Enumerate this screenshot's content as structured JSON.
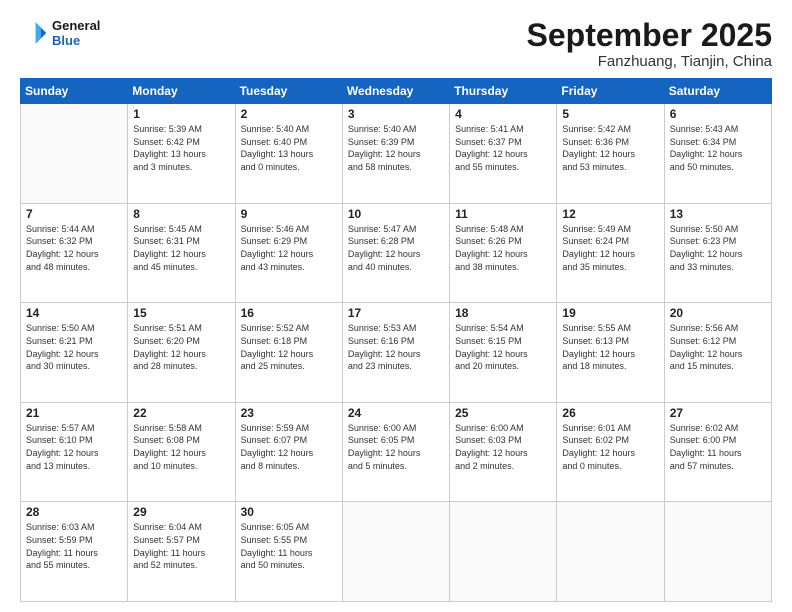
{
  "header": {
    "logo_line1": "General",
    "logo_line2": "Blue",
    "month": "September 2025",
    "location": "Fanzhuang, Tianjin, China"
  },
  "weekdays": [
    "Sunday",
    "Monday",
    "Tuesday",
    "Wednesday",
    "Thursday",
    "Friday",
    "Saturday"
  ],
  "weeks": [
    [
      {
        "day": "",
        "info": ""
      },
      {
        "day": "1",
        "info": "Sunrise: 5:39 AM\nSunset: 6:42 PM\nDaylight: 13 hours\nand 3 minutes."
      },
      {
        "day": "2",
        "info": "Sunrise: 5:40 AM\nSunset: 6:40 PM\nDaylight: 13 hours\nand 0 minutes."
      },
      {
        "day": "3",
        "info": "Sunrise: 5:40 AM\nSunset: 6:39 PM\nDaylight: 12 hours\nand 58 minutes."
      },
      {
        "day": "4",
        "info": "Sunrise: 5:41 AM\nSunset: 6:37 PM\nDaylight: 12 hours\nand 55 minutes."
      },
      {
        "day": "5",
        "info": "Sunrise: 5:42 AM\nSunset: 6:36 PM\nDaylight: 12 hours\nand 53 minutes."
      },
      {
        "day": "6",
        "info": "Sunrise: 5:43 AM\nSunset: 6:34 PM\nDaylight: 12 hours\nand 50 minutes."
      }
    ],
    [
      {
        "day": "7",
        "info": "Sunrise: 5:44 AM\nSunset: 6:32 PM\nDaylight: 12 hours\nand 48 minutes."
      },
      {
        "day": "8",
        "info": "Sunrise: 5:45 AM\nSunset: 6:31 PM\nDaylight: 12 hours\nand 45 minutes."
      },
      {
        "day": "9",
        "info": "Sunrise: 5:46 AM\nSunset: 6:29 PM\nDaylight: 12 hours\nand 43 minutes."
      },
      {
        "day": "10",
        "info": "Sunrise: 5:47 AM\nSunset: 6:28 PM\nDaylight: 12 hours\nand 40 minutes."
      },
      {
        "day": "11",
        "info": "Sunrise: 5:48 AM\nSunset: 6:26 PM\nDaylight: 12 hours\nand 38 minutes."
      },
      {
        "day": "12",
        "info": "Sunrise: 5:49 AM\nSunset: 6:24 PM\nDaylight: 12 hours\nand 35 minutes."
      },
      {
        "day": "13",
        "info": "Sunrise: 5:50 AM\nSunset: 6:23 PM\nDaylight: 12 hours\nand 33 minutes."
      }
    ],
    [
      {
        "day": "14",
        "info": "Sunrise: 5:50 AM\nSunset: 6:21 PM\nDaylight: 12 hours\nand 30 minutes."
      },
      {
        "day": "15",
        "info": "Sunrise: 5:51 AM\nSunset: 6:20 PM\nDaylight: 12 hours\nand 28 minutes."
      },
      {
        "day": "16",
        "info": "Sunrise: 5:52 AM\nSunset: 6:18 PM\nDaylight: 12 hours\nand 25 minutes."
      },
      {
        "day": "17",
        "info": "Sunrise: 5:53 AM\nSunset: 6:16 PM\nDaylight: 12 hours\nand 23 minutes."
      },
      {
        "day": "18",
        "info": "Sunrise: 5:54 AM\nSunset: 6:15 PM\nDaylight: 12 hours\nand 20 minutes."
      },
      {
        "day": "19",
        "info": "Sunrise: 5:55 AM\nSunset: 6:13 PM\nDaylight: 12 hours\nand 18 minutes."
      },
      {
        "day": "20",
        "info": "Sunrise: 5:56 AM\nSunset: 6:12 PM\nDaylight: 12 hours\nand 15 minutes."
      }
    ],
    [
      {
        "day": "21",
        "info": "Sunrise: 5:57 AM\nSunset: 6:10 PM\nDaylight: 12 hours\nand 13 minutes."
      },
      {
        "day": "22",
        "info": "Sunrise: 5:58 AM\nSunset: 6:08 PM\nDaylight: 12 hours\nand 10 minutes."
      },
      {
        "day": "23",
        "info": "Sunrise: 5:59 AM\nSunset: 6:07 PM\nDaylight: 12 hours\nand 8 minutes."
      },
      {
        "day": "24",
        "info": "Sunrise: 6:00 AM\nSunset: 6:05 PM\nDaylight: 12 hours\nand 5 minutes."
      },
      {
        "day": "25",
        "info": "Sunrise: 6:00 AM\nSunset: 6:03 PM\nDaylight: 12 hours\nand 2 minutes."
      },
      {
        "day": "26",
        "info": "Sunrise: 6:01 AM\nSunset: 6:02 PM\nDaylight: 12 hours\nand 0 minutes."
      },
      {
        "day": "27",
        "info": "Sunrise: 6:02 AM\nSunset: 6:00 PM\nDaylight: 11 hours\nand 57 minutes."
      }
    ],
    [
      {
        "day": "28",
        "info": "Sunrise: 6:03 AM\nSunset: 5:59 PM\nDaylight: 11 hours\nand 55 minutes."
      },
      {
        "day": "29",
        "info": "Sunrise: 6:04 AM\nSunset: 5:57 PM\nDaylight: 11 hours\nand 52 minutes."
      },
      {
        "day": "30",
        "info": "Sunrise: 6:05 AM\nSunset: 5:55 PM\nDaylight: 11 hours\nand 50 minutes."
      },
      {
        "day": "",
        "info": ""
      },
      {
        "day": "",
        "info": ""
      },
      {
        "day": "",
        "info": ""
      },
      {
        "day": "",
        "info": ""
      }
    ]
  ]
}
